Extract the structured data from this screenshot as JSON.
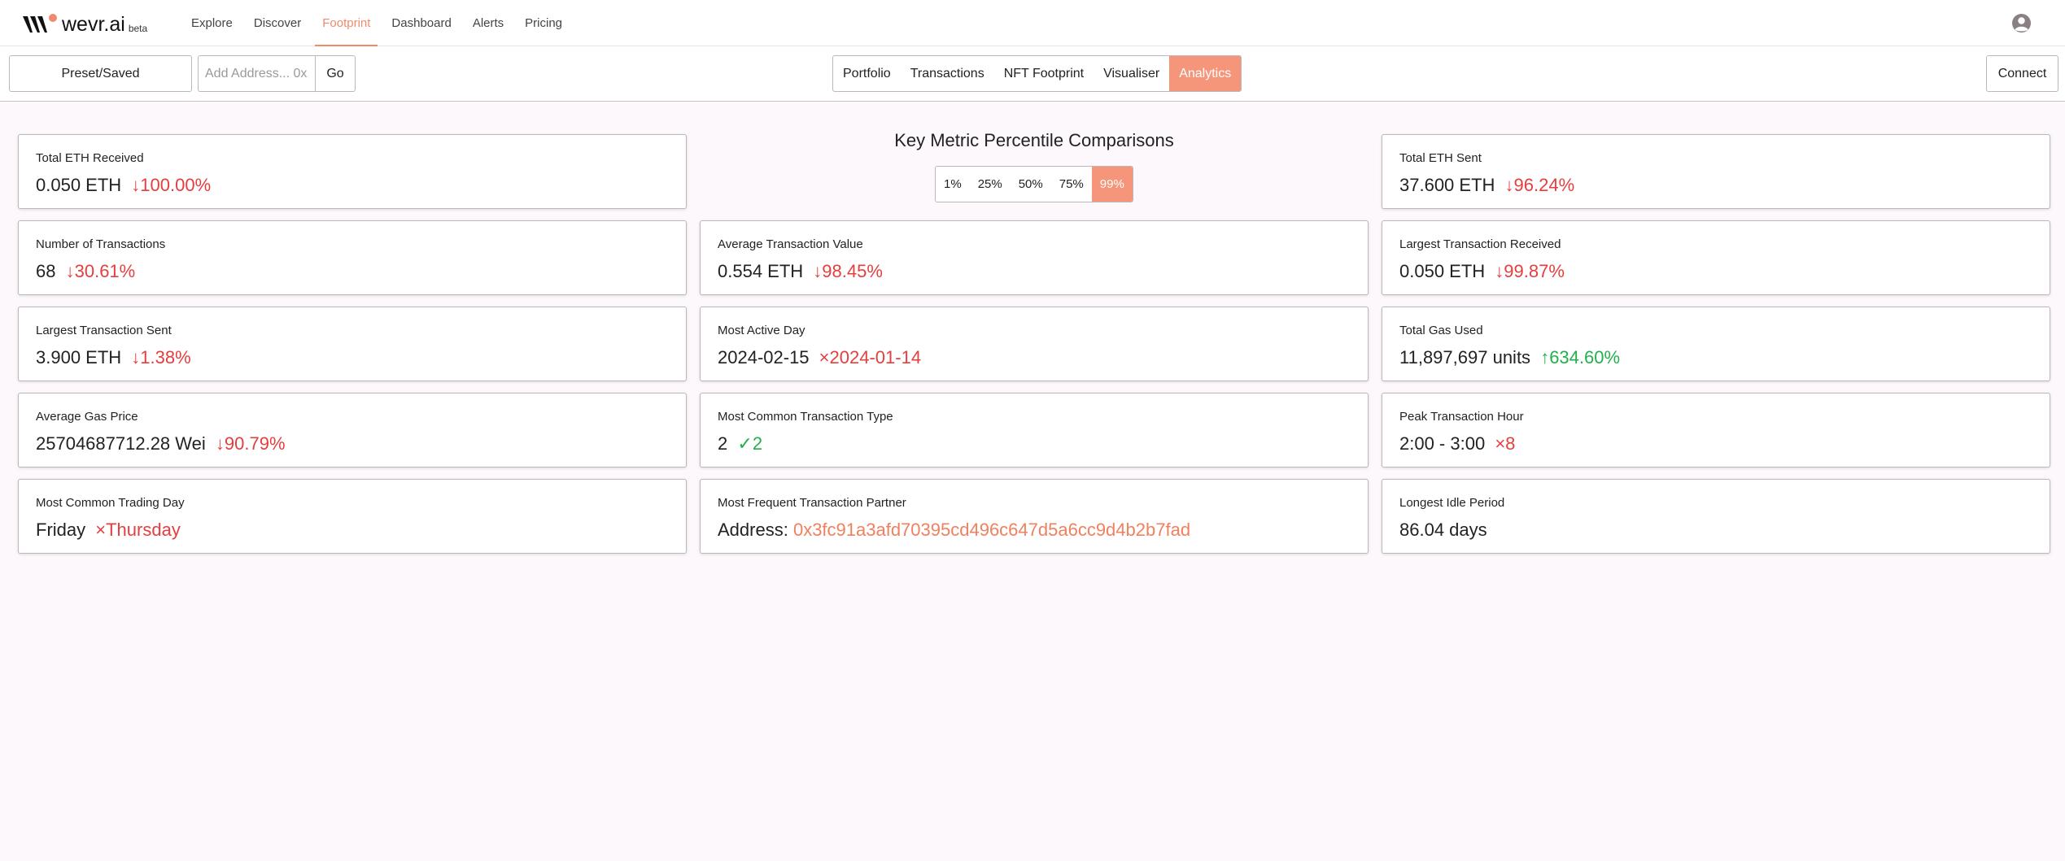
{
  "brand": {
    "name": "wevr.ai",
    "badge": "beta",
    "accent": "#f08a6c",
    "up_color": "#22b04a",
    "down_color": "#e53e3e"
  },
  "nav": {
    "links": [
      {
        "label": "Explore"
      },
      {
        "label": "Discover"
      },
      {
        "label": "Footprint",
        "active": true
      },
      {
        "label": "Dashboard"
      },
      {
        "label": "Alerts"
      },
      {
        "label": "Pricing"
      }
    ],
    "avatar_icon": "user-circle-icon"
  },
  "toolbar": {
    "preset_label": "Preset/Saved",
    "address_placeholder": "Add Address... 0x...",
    "go_label": "Go",
    "tabs": [
      {
        "label": "Portfolio"
      },
      {
        "label": "Transactions"
      },
      {
        "label": "NFT Footprint"
      },
      {
        "label": "Visualiser"
      },
      {
        "label": "Analytics",
        "active": true
      }
    ],
    "connect_label": "Connect"
  },
  "comparison": {
    "title": "Key Metric Percentile Comparisons",
    "percentiles": [
      "1%",
      "25%",
      "50%",
      "75%",
      "99%"
    ],
    "selected": "99%"
  },
  "metrics": {
    "total_eth_received": {
      "label": "Total ETH Received",
      "value": "0.050 ETH",
      "ind_icon": "↓",
      "ind_text": "100.00%",
      "trend": "down"
    },
    "total_eth_sent": {
      "label": "Total ETH Sent",
      "value": "37.600 ETH",
      "ind_icon": "↓",
      "ind_text": "96.24%",
      "trend": "down"
    },
    "num_transactions": {
      "label": "Number of Transactions",
      "value": "68",
      "ind_icon": "↓",
      "ind_text": "30.61%",
      "trend": "down"
    },
    "avg_tx_value": {
      "label": "Average Transaction Value",
      "value": "0.554 ETH",
      "ind_icon": "↓",
      "ind_text": "98.45%",
      "trend": "down"
    },
    "largest_received": {
      "label": "Largest Transaction Received",
      "value": "0.050 ETH",
      "ind_icon": "↓",
      "ind_text": "99.87%",
      "trend": "down"
    },
    "largest_sent": {
      "label": "Largest Transaction Sent",
      "value": "3.900 ETH",
      "ind_icon": "↓",
      "ind_text": "1.38%",
      "trend": "down"
    },
    "most_active_day": {
      "label": "Most Active Day",
      "value": "2024-02-15",
      "ind_icon": "×",
      "ind_text": "2024-01-14",
      "trend": "mismatch"
    },
    "total_gas_used": {
      "label": "Total Gas Used",
      "value": "11,897,697 units",
      "ind_icon": "↑",
      "ind_text": "634.60%",
      "trend": "up"
    },
    "avg_gas_price": {
      "label": "Average Gas Price",
      "value": "25704687712.28 Wei",
      "ind_icon": "↓",
      "ind_text": "90.79%",
      "trend": "down"
    },
    "common_tx_type": {
      "label": "Most Common Transaction Type",
      "value": "2",
      "ind_icon": "✓",
      "ind_text": "2",
      "trend": "match"
    },
    "peak_hour": {
      "label": "Peak Transaction Hour",
      "value": "2:00 - 3:00",
      "ind_icon": "×",
      "ind_text": "8",
      "trend": "mismatch"
    },
    "common_trading_day": {
      "label": "Most Common Trading Day",
      "value": "Friday",
      "ind_icon": "×",
      "ind_text": "Thursday",
      "trend": "mismatch"
    },
    "frequent_partner": {
      "label": "Most Frequent Transaction Partner",
      "value_prefix": "Address:",
      "address": "0x3fc91a3afd70395cd496c647d5a6cc9d4b2b7fad"
    },
    "longest_idle": {
      "label": "Longest Idle Period",
      "value": "86.04 days"
    }
  }
}
